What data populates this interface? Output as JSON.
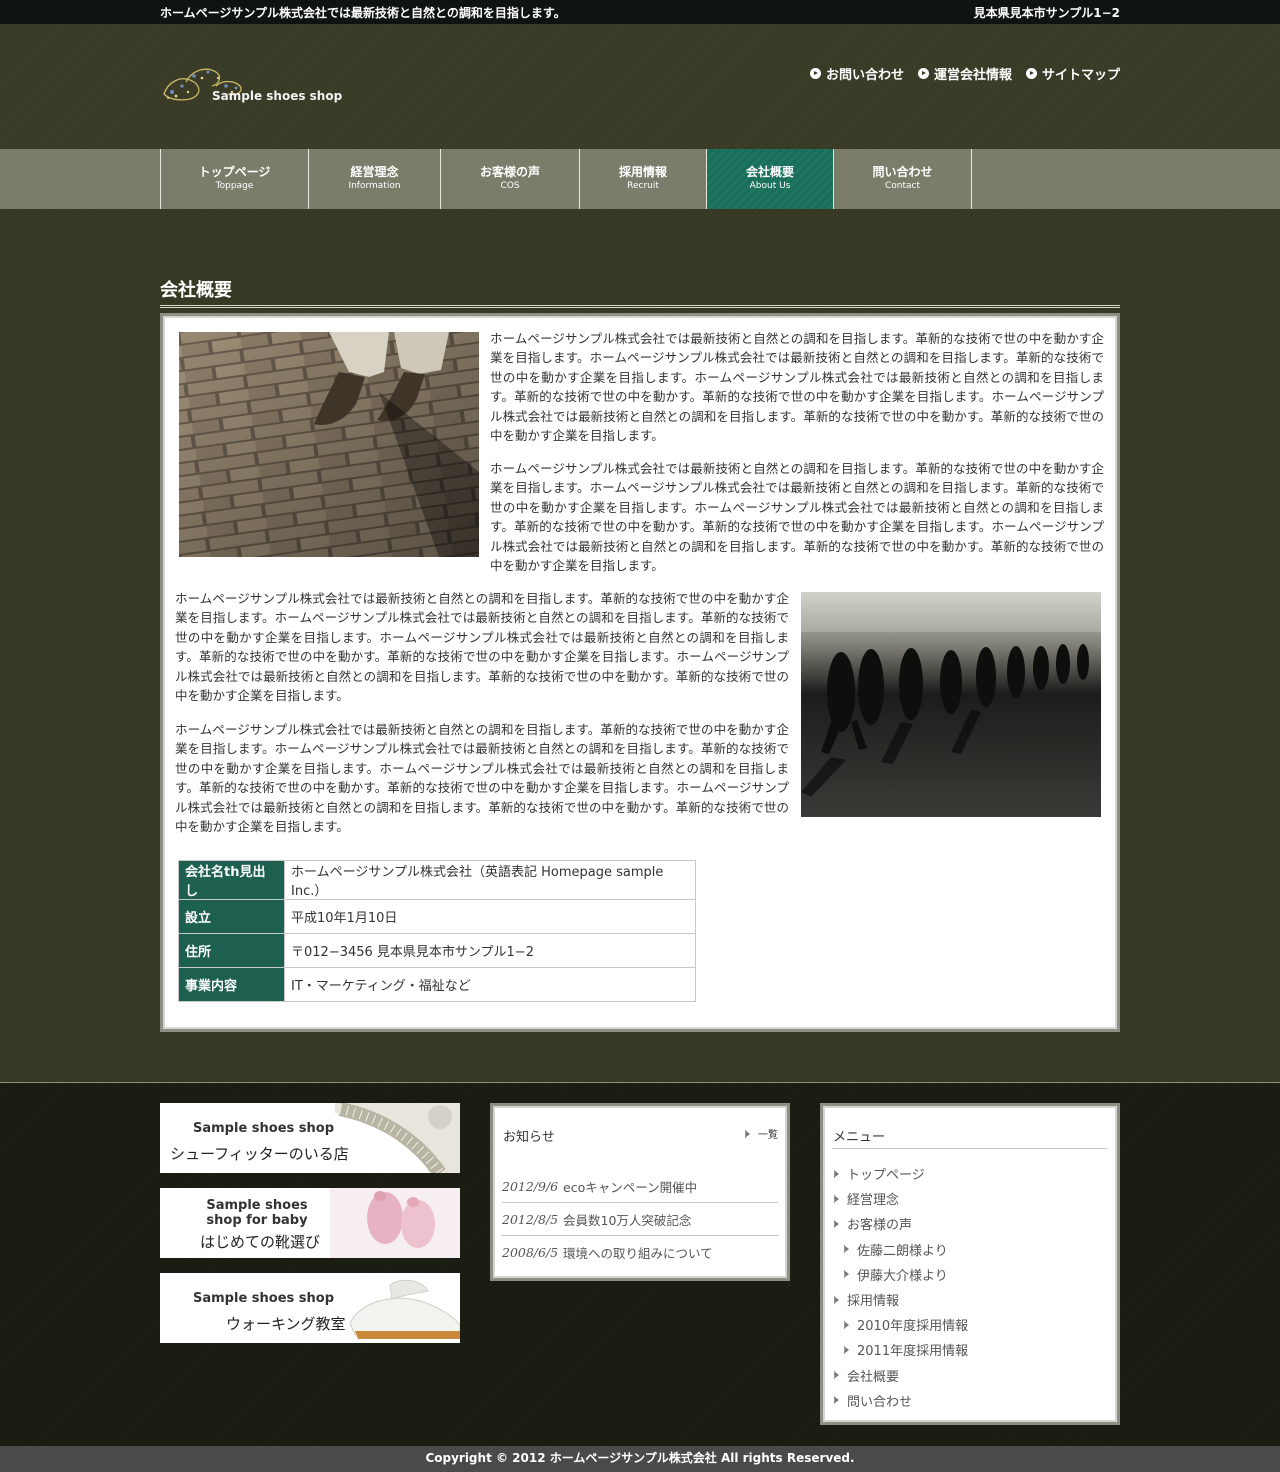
{
  "topbar": {
    "tagline": "ホームページサンプル株式会社では最新技術と自然との調和を目指します。",
    "address": "見本県見本市サンプル1−2"
  },
  "header": {
    "logo_text": "Sample shoes shop",
    "util_links": [
      "お問い合わせ",
      "運営会社情報",
      "サイトマップ"
    ]
  },
  "nav": {
    "items": [
      {
        "ja": "トップページ",
        "en": "Toppage"
      },
      {
        "ja": "経営理念",
        "en": "Information"
      },
      {
        "ja": "お客様の声",
        "en": "COS"
      },
      {
        "ja": "採用情報",
        "en": "Recruit"
      },
      {
        "ja": "会社概要",
        "en": "About Us"
      },
      {
        "ja": "問い合わせ",
        "en": "Contact"
      }
    ],
    "active_index": 4
  },
  "main": {
    "title": "会社概要",
    "paragraphs": [
      "ホームページサンプル株式会社では最新技術と自然との調和を目指します。革新的な技術で世の中を動かす企業を目指します。ホームページサンプル株式会社では最新技術と自然との調和を目指します。革新的な技術で世の中を動かす企業を目指します。ホームページサンプル株式会社では最新技術と自然との調和を目指します。革新的な技術で世の中を動かす。革新的な技術で世の中を動かす企業を目指します。ホームページサンプル株式会社では最新技術と自然との調和を目指します。革新的な技術で世の中を動かす。革新的な技術で世の中を動かす企業を目指します。",
      "ホームページサンプル株式会社では最新技術と自然との調和を目指します。革新的な技術で世の中を動かす企業を目指します。ホームページサンプル株式会社では最新技術と自然との調和を目指します。革新的な技術で世の中を動かす企業を目指します。ホームページサンプル株式会社では最新技術と自然との調和を目指します。革新的な技術で世の中を動かす。革新的な技術で世の中を動かす企業を目指します。ホームページサンプル株式会社では最新技術と自然との調和を目指します。革新的な技術で世の中を動かす。革新的な技術で世の中を動かす企業を目指します。",
      "ホームページサンプル株式会社では最新技術と自然との調和を目指します。革新的な技術で世の中を動かす企業を目指します。ホームページサンプル株式会社では最新技術と自然との調和を目指します。革新的な技術で世の中を動かす企業を目指します。ホームページサンプル株式会社では最新技術と自然との調和を目指します。革新的な技術で世の中を動かす。革新的な技術で世の中を動かす企業を目指します。ホームページサンプル株式会社では最新技術と自然との調和を目指します。革新的な技術で世の中を動かす。革新的な技術で世の中を動かす企業を目指します。",
      "ホームページサンプル株式会社では最新技術と自然との調和を目指します。革新的な技術で世の中を動かす企業を目指します。ホームページサンプル株式会社では最新技術と自然との調和を目指します。革新的な技術で世の中を動かす企業を目指します。ホームページサンプル株式会社では最新技術と自然との調和を目指します。革新的な技術で世の中を動かす。革新的な技術で世の中を動かす企業を目指します。ホームページサンプル株式会社では最新技術と自然との調和を目指します。革新的な技術で世の中を動かす。革新的な技術で世の中を動かす企業を目指します。"
    ],
    "table": [
      {
        "th": "会社名th見出し",
        "td": "ホームページサンプル株式会社（英語表記 Homepage sample Inc.）"
      },
      {
        "th": "設立",
        "td": "平成10年1月10日"
      },
      {
        "th": "住所",
        "td": "〒012−3456 見本県見本市サンプル1−2"
      },
      {
        "th": "事業内容",
        "td": "IT・マーケティング・福祉など"
      }
    ]
  },
  "footer": {
    "banners": [
      {
        "en": "Sample shoes shop",
        "ja": "シューフィッターのいる店"
      },
      {
        "en": "Sample shoes shop for baby",
        "ja": "はじめての靴選び"
      },
      {
        "en": "Sample shoes shop",
        "ja": "ウォーキング教室"
      }
    ],
    "news": {
      "title": "お知らせ",
      "more": "一覧",
      "items": [
        {
          "date": "2012/9/6",
          "text": "ecoキャンペーン開催中"
        },
        {
          "date": "2012/8/5",
          "text": "会員数10万人突破記念"
        },
        {
          "date": "2008/6/5",
          "text": "環境への取り組みについて"
        }
      ]
    },
    "menu": {
      "title": "メニュー",
      "items": [
        {
          "label": "トップページ",
          "sub": false
        },
        {
          "label": "経営理念",
          "sub": false
        },
        {
          "label": "お客様の声",
          "sub": false
        },
        {
          "label": "佐藤二朗様より",
          "sub": true
        },
        {
          "label": "伊藤大介様より",
          "sub": true
        },
        {
          "label": "採用情報",
          "sub": false
        },
        {
          "label": "2010年度採用情報",
          "sub": true
        },
        {
          "label": "2011年度採用情報",
          "sub": true
        },
        {
          "label": "会社概要",
          "sub": false
        },
        {
          "label": "問い合わせ",
          "sub": false
        }
      ]
    },
    "copyright": "Copyright © 2012 ホームページサンプル株式会社 All rights Reserved."
  },
  "colors": {
    "accent_green": "#1d7560",
    "table_header": "#1d6050",
    "background_olive": "#35361f",
    "nav_gray": "#7c7c6a"
  }
}
